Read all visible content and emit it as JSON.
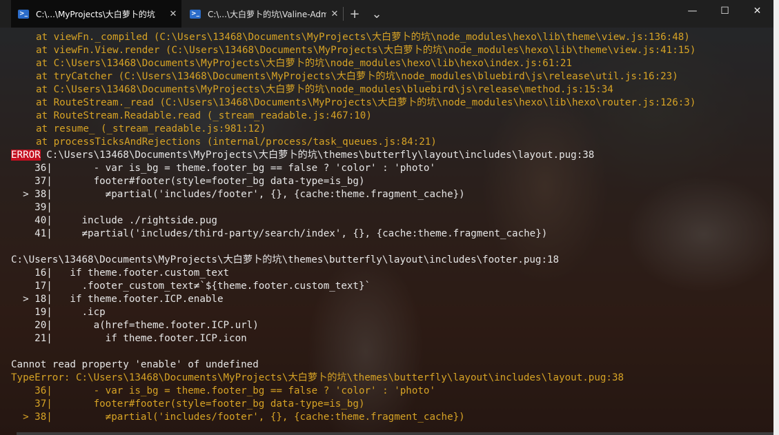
{
  "tabs": [
    {
      "label": "C:\\...\\MyProjects\\大白萝卜的坑",
      "active": true
    },
    {
      "label": "C:\\...\\大白萝卜的坑\\Valine-Admi",
      "active": false
    }
  ],
  "tab_close": "✕",
  "new_tab": "+",
  "dropdown": "⌄",
  "window_controls": {
    "minimize": "—",
    "maximize": "☐",
    "close": "✕"
  },
  "terminal": {
    "stack_lines": [
      "at viewFn._compiled (C:\\Users\\13468\\Documents\\MyProjects\\大白萝卜的坑\\node_modules\\hexo\\lib\\theme\\view.js:136:48)",
      "at viewFn.View.render (C:\\Users\\13468\\Documents\\MyProjects\\大白萝卜的坑\\node_modules\\hexo\\lib\\theme\\view.js:41:15)",
      "at C:\\Users\\13468\\Documents\\MyProjects\\大白萝卜的坑\\node_modules\\hexo\\lib\\hexo\\index.js:61:21",
      "at tryCatcher (C:\\Users\\13468\\Documents\\MyProjects\\大白萝卜的坑\\node_modules\\bluebird\\js\\release\\util.js:16:23)",
      "at C:\\Users\\13468\\Documents\\MyProjects\\大白萝卜的坑\\node_modules\\bluebird\\js\\release\\method.js:15:34",
      "at RouteStream._read (C:\\Users\\13468\\Documents\\MyProjects\\大白萝卜的坑\\node_modules\\hexo\\lib\\hexo\\router.js:126:3)",
      "at RouteStream.Readable.read (_stream_readable.js:467:10)",
      "at resume_ (_stream_readable.js:981:12)",
      "at processTicksAndRejections (internal/process/task_queues.js:84:21)"
    ],
    "error_label": "ERROR",
    "error_path": " C:\\Users\\13468\\Documents\\MyProjects\\大白萝卜的坑\\themes\\butterfly\\layout\\includes\\layout.pug:38",
    "layout_block": [
      "    36|       - var is_bg = theme.footer_bg == false ? 'color' : 'photo'",
      "    37|       footer#footer(style=footer_bg data-type=is_bg)",
      "  > 38|         ≠partial('includes/footer', {}, {cache:theme.fragment_cache})",
      "    39|",
      "    40|     include ./rightside.pug",
      "    41|     ≠partial('includes/third-party/search/index', {}, {cache:theme.fragment_cache})"
    ],
    "footer_path": "C:\\Users\\13468\\Documents\\MyProjects\\大白萝卜的坑\\themes\\butterfly\\layout\\includes\\footer.pug:18",
    "footer_block": [
      "    16|   if theme.footer.custom_text",
      "    17|     .footer_custom_text≠`${theme.footer.custom_text}`",
      "  > 18|   if theme.footer.ICP.enable",
      "    19|     .icp",
      "    20|       a(href=theme.footer.ICP.url)",
      "    21|         if theme.footer.ICP.icon"
    ],
    "message": "Cannot read property 'enable' of undefined",
    "type_error": "TypeError: C:\\Users\\13468\\Documents\\MyProjects\\大白萝卜的坑\\themes\\butterfly\\layout\\includes\\layout.pug:38",
    "type_error_block": [
      "    36|       - var is_bg = theme.footer_bg == false ? 'color' : 'photo'",
      "    37|       footer#footer(style=footer_bg data-type=is_bg)",
      "  > 38|         ≠partial('includes/footer', {}, {cache:theme.fragment_cache})"
    ]
  },
  "colors": {
    "stack": "#d7a325",
    "plain": "#e6e6e6",
    "error_bg": "#c50f1f",
    "tab_active": "#0c0c0c",
    "tabbar": "#1f1f1f"
  }
}
